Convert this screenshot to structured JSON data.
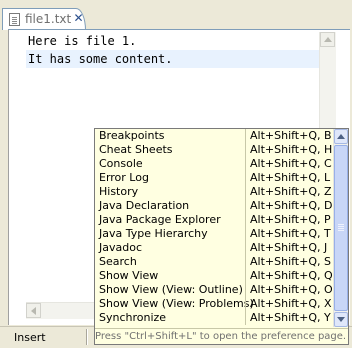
{
  "tab": {
    "label": "file1.txt",
    "file_icon": "text-file-icon",
    "close_icon": "close-icon"
  },
  "editor": {
    "lines": [
      "Here is file 1.",
      "It has some content."
    ],
    "current_line_color": "#e8f2fe"
  },
  "status": {
    "mode": "Insert"
  },
  "quick_access": {
    "items": [
      {
        "name": "Breakpoints",
        "shortcut": "Alt+Shift+Q, B"
      },
      {
        "name": "Cheat Sheets",
        "shortcut": "Alt+Shift+Q, H"
      },
      {
        "name": "Console",
        "shortcut": "Alt+Shift+Q, C"
      },
      {
        "name": "Error Log",
        "shortcut": "Alt+Shift+Q, L"
      },
      {
        "name": "History",
        "shortcut": "Alt+Shift+Q, Z"
      },
      {
        "name": "Java Declaration",
        "shortcut": "Alt+Shift+Q, D"
      },
      {
        "name": "Java Package Explorer",
        "shortcut": "Alt+Shift+Q, P"
      },
      {
        "name": "Java Type Hierarchy",
        "shortcut": "Alt+Shift+Q, T"
      },
      {
        "name": "Javadoc",
        "shortcut": "Alt+Shift+Q, J"
      },
      {
        "name": "Search",
        "shortcut": "Alt+Shift+Q, S"
      },
      {
        "name": "Show View",
        "shortcut": "Alt+Shift+Q, Q"
      },
      {
        "name": "Show View (View: Outline)",
        "shortcut": "Alt+Shift+Q, O"
      },
      {
        "name": "Show View (View: Problems)",
        "shortcut": "Alt+Shift+Q, X"
      },
      {
        "name": "Synchronize",
        "shortcut": "Alt+Shift+Q, Y"
      }
    ],
    "hint": "Press \"Ctrl+Shift+L\" to open the preference page.",
    "background_color": "#ffffe1"
  }
}
